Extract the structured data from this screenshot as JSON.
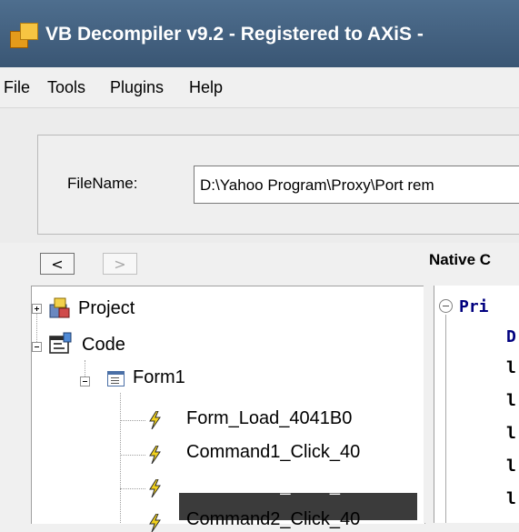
{
  "window": {
    "title": "VB Decompiler v9.2 - Registered to AXiS -"
  },
  "menu": {
    "items": [
      "File",
      "Tools",
      "Plugins",
      "Help"
    ]
  },
  "file": {
    "label": "FileName:",
    "value": "D:\\Yahoo Program\\Proxy\\Port rem"
  },
  "nav": {
    "back_label": "<",
    "forward_label": ">",
    "native_label": "Native C"
  },
  "tree": {
    "project_label": "Project",
    "code_label": "Code",
    "form1_label": "Form1",
    "events": [
      "Form_Load_4041B0",
      "Command1_Click_40",
      "Command3_Click_40",
      "Command2_Click_40"
    ],
    "selected_index": 2
  },
  "code": {
    "lines": [
      "Pri",
      "D",
      "l",
      "l",
      "l",
      "l",
      "l"
    ]
  },
  "colors": {
    "title_bar": "#3e5b7a",
    "selection": "#3b3b3b",
    "keyword": "#00007f"
  }
}
